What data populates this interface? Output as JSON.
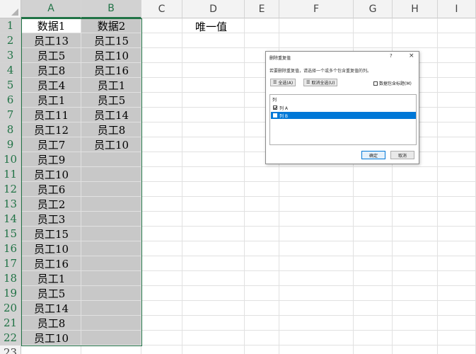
{
  "columns": [
    "A",
    "B",
    "C",
    "D",
    "E",
    "F",
    "G",
    "H",
    "I"
  ],
  "rows": [
    "1",
    "2",
    "3",
    "4",
    "5",
    "6",
    "7",
    "8",
    "9",
    "10",
    "11",
    "12",
    "13",
    "14",
    "15",
    "16",
    "17",
    "18",
    "19",
    "20",
    "21",
    "22",
    "23"
  ],
  "cells": {
    "col_a": [
      "数据1",
      "员工13",
      "员工5",
      "员工8",
      "员工4",
      "员工1",
      "员工11",
      "员工12",
      "员工7",
      "员工9",
      "员工10",
      "员工6",
      "员工2",
      "员工3",
      "员工15",
      "员工10",
      "员工16",
      "员工1",
      "员工5",
      "员工14",
      "员工8",
      "员工10"
    ],
    "col_b": [
      "数据2",
      "员工15",
      "员工10",
      "员工16",
      "员工1",
      "员工5",
      "员工14",
      "员工8",
      "员工10"
    ],
    "d1": "唯一值"
  },
  "dialog": {
    "title": "删除重复值",
    "help": "?",
    "close": "×",
    "instruction": "若要删除重复值，请选择一个或多个包含重复值的列。",
    "select_all": "全选(A)",
    "unselect_all": "取消全选(U)",
    "header_checkbox": "数据包含标题(M)",
    "list_header": "列",
    "list_items": [
      {
        "label": "列 A",
        "checked": true
      },
      {
        "label": "列 B",
        "checked": false
      }
    ],
    "ok": "确定",
    "cancel": "取消"
  },
  "colors": {
    "accent": "#217346",
    "selection_fill": "#c8c8c8",
    "highlight": "#0078d7",
    "arrow": "#e03c3c"
  }
}
